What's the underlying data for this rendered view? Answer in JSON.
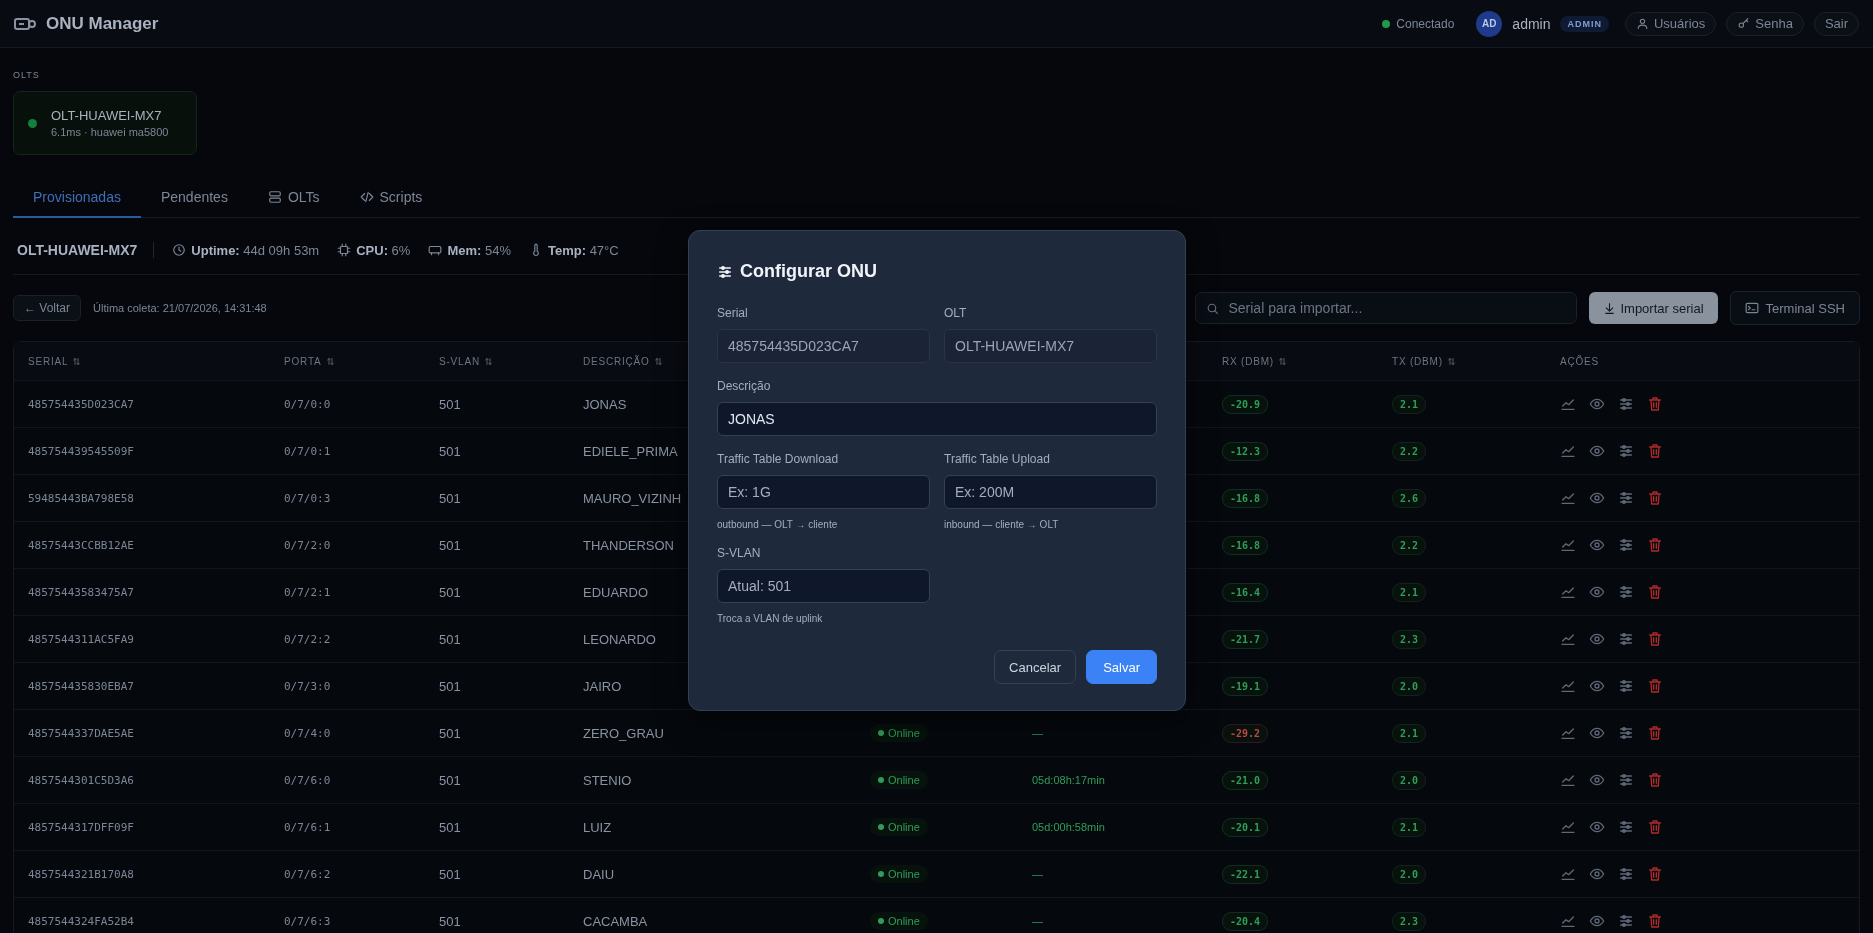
{
  "header": {
    "title": "ONU Manager",
    "connection": {
      "text": "Conectado",
      "connected": true
    },
    "user": {
      "initials": "AD",
      "name": "admin",
      "role": "ADMIN"
    },
    "buttons": [
      "Usuários",
      "Senha",
      "Sair"
    ]
  },
  "olts": {
    "label": "OLTS",
    "items": [
      {
        "name": "OLT-HUAWEI-MX7",
        "detail": "6.1ms · huawei ma5800",
        "online": true
      }
    ]
  },
  "tabs": [
    {
      "label": "Provisionadas",
      "selected": true
    },
    {
      "label": "Pendentes",
      "selected": false
    },
    {
      "label": "OLTs",
      "selected": false
    },
    {
      "label": "Scripts",
      "selected": false
    }
  ],
  "olt_stats": {
    "name": "OLT-HUAWEI-MX7",
    "items": [
      {
        "label": "Uptime:",
        "value": "44d 09h 53m"
      },
      {
        "label": "CPU:",
        "value": "6%"
      },
      {
        "label": "Mem:",
        "value": "54%"
      },
      {
        "label": "Temp:",
        "value": "47°C"
      }
    ]
  },
  "toolbar": {
    "back": "← Voltar",
    "last_collect": "Última coleta: 21/07/2026, 14:31:48",
    "search": {
      "placeholder": "Serial para importar..."
    },
    "import": "Importar serial",
    "terminal": "Terminal SSH"
  },
  "table": {
    "columns": [
      {
        "label": "SERIAL",
        "sortable": true
      },
      {
        "label": "PORTA",
        "sortable": true
      },
      {
        "label": "S-VLAN",
        "sortable": true
      },
      {
        "label": "DESCRIÇÃO",
        "sortable": true
      },
      {
        "label": "RX (DBM)",
        "sortable": true
      },
      {
        "label": "TX (DBM)",
        "sortable": true
      },
      {
        "label": "AÇÕES",
        "sortable": false
      }
    ],
    "rows": [
      {
        "serial": "485754435D023CA7",
        "port": "0/7/0:0",
        "svlan": "501",
        "description": "JONAS",
        "rx": {
          "value": "-20.9",
          "color": "#2f9e5a"
        },
        "tx": "2.1"
      },
      {
        "serial": "485754439545509F",
        "port": "0/7/0:1",
        "svlan": "501",
        "description": "EDIELE_PRIMA",
        "rx": {
          "value": "-12.3",
          "color": "#2f9e5a"
        },
        "tx": "2.2"
      },
      {
        "serial": "59485443BA798E58",
        "port": "0/7/0:3",
        "svlan": "501",
        "description": "MAURO_VIZINH",
        "rx": {
          "value": "-16.8",
          "color": "#2f9e5a"
        },
        "tx": "2.6"
      },
      {
        "serial": "48575443CCBB12AE",
        "port": "0/7/2:0",
        "svlan": "501",
        "description": "THANDERSON",
        "rx": {
          "value": "-16.8",
          "color": "#2f9e5a"
        },
        "tx": "2.2"
      },
      {
        "serial": "48575443583475A7",
        "port": "0/7/2:1",
        "svlan": "501",
        "description": "EDUARDO",
        "rx": {
          "value": "-16.4",
          "color": "#2f9e5a"
        },
        "tx": "2.1"
      },
      {
        "serial": "4857544311AC5FA9",
        "port": "0/7/2:2",
        "svlan": "501",
        "description": "LEONARDO",
        "rx": {
          "value": "-21.7",
          "color": "#2f9e5a"
        },
        "tx": "2.3"
      },
      {
        "serial": "485754435830EBA7",
        "port": "0/7/3:0",
        "svlan": "501",
        "description": "JAIRO",
        "rx": {
          "value": "-19.1",
          "color": "#2f9e5a"
        },
        "tx": "2.0"
      },
      {
        "serial": "4857544337DAE5AE",
        "port": "0/7/4:0",
        "svlan": "501",
        "description": "ZERO_GRAU",
        "status": "Online",
        "uptime": "—",
        "rx": {
          "value": "-29.2",
          "color": "#c24545"
        },
        "tx": "2.1"
      },
      {
        "serial": "4857544301C5D3A6",
        "port": "0/7/6:0",
        "svlan": "501",
        "description": "STENIO",
        "status": "Online",
        "uptime": "05d:08h:17min",
        "rx": {
          "value": "-21.0",
          "color": "#2f9e5a"
        },
        "tx": "2.0"
      },
      {
        "serial": "4857544317DFF09F",
        "port": "0/7/6:1",
        "svlan": "501",
        "description": "LUIZ",
        "status": "Online",
        "uptime": "05d:00h:58min",
        "rx": {
          "value": "-20.1",
          "color": "#2f9e5a"
        },
        "tx": "2.1"
      },
      {
        "serial": "4857544321B170A8",
        "port": "0/7/6:2",
        "svlan": "501",
        "description": "DAIU",
        "status": "Online",
        "uptime": "—",
        "rx": {
          "value": "-22.1",
          "color": "#2f9e5a"
        },
        "tx": "2.0"
      },
      {
        "serial": "4857544324FA52B4",
        "port": "0/7/6:3",
        "svlan": "501",
        "description": "CACAMBA",
        "status": "Online",
        "uptime": "—",
        "rx": {
          "value": "-20.4",
          "color": "#2f9e5a"
        },
        "tx": "2.3"
      }
    ]
  },
  "modal": {
    "title": "Configurar ONU",
    "fields": [
      {
        "label": "Serial",
        "value": "485754435D023CA7",
        "disabled": true,
        "wide": false
      },
      {
        "label": "OLT",
        "value": "OLT-HUAWEI-MX7",
        "disabled": true,
        "wide": false
      },
      {
        "label": "Descrição",
        "value": "JONAS",
        "disabled": false,
        "wide": true
      },
      {
        "label": "Traffic Table Download",
        "placeholder": "Ex: 1G",
        "hint": "outbound — OLT → cliente",
        "disabled": false,
        "wide": false
      },
      {
        "label": "Traffic Table Upload",
        "placeholder": "Ex: 200M",
        "hint": "inbound — cliente → OLT",
        "disabled": false,
        "wide": false
      },
      {
        "label": "S-VLAN",
        "placeholder": "Atual: 501",
        "hint": "Troca a VLAN de uplink",
        "disabled": false,
        "wide": false
      }
    ],
    "buttons": [
      {
        "label": "Cancelar",
        "kind": "secondary"
      },
      {
        "label": "Salvar",
        "kind": "primary"
      }
    ]
  }
}
